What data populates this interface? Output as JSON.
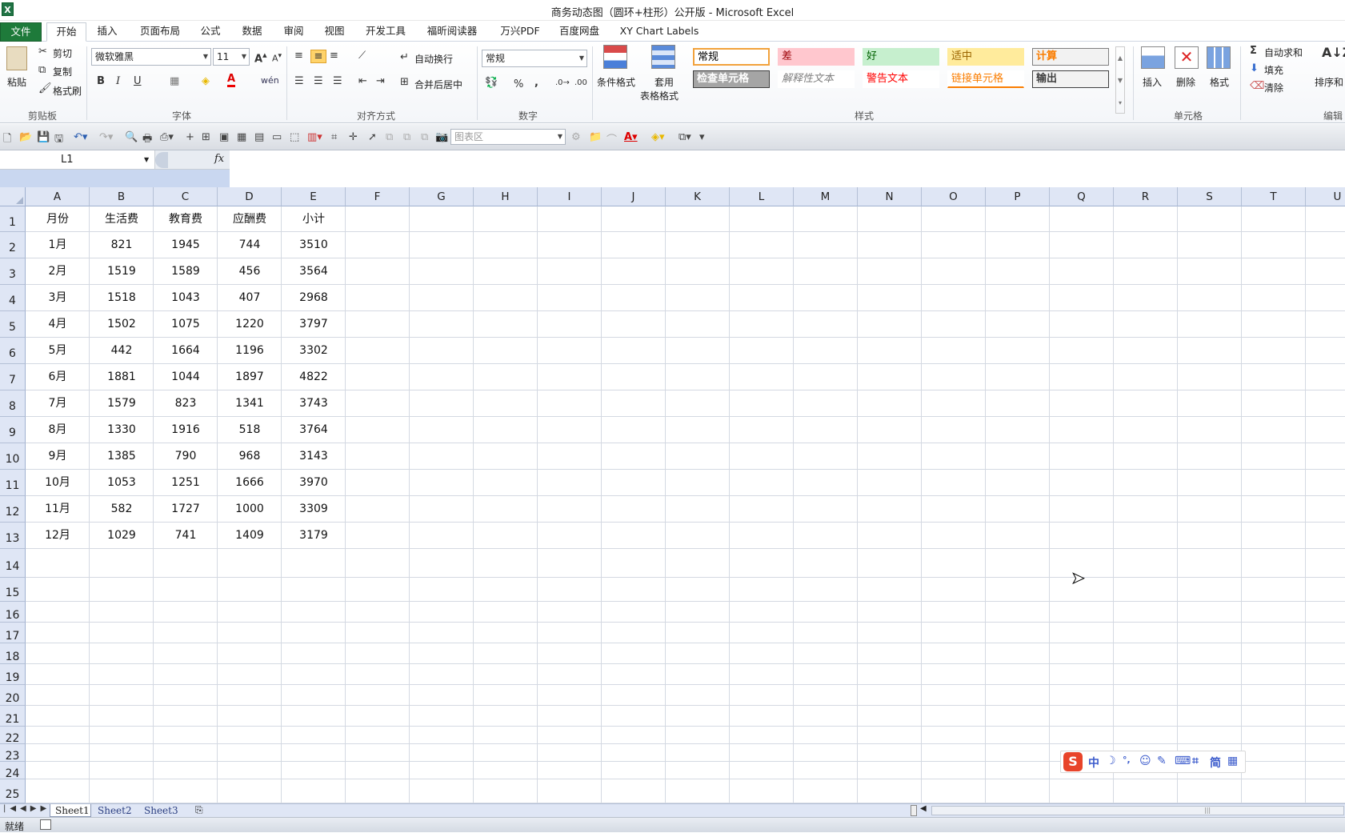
{
  "window": {
    "title": "商务动态图（圆环+柱形）公开版 - Microsoft Excel",
    "app_icon": "X"
  },
  "tabs": [
    "文件",
    "开始",
    "插入",
    "页面布局",
    "公式",
    "数据",
    "审阅",
    "视图",
    "开发工具",
    "福昕阅读器",
    "万兴PDF",
    "百度网盘",
    "XY Chart Labels"
  ],
  "ribbon": {
    "clipboard": {
      "paste": "粘贴",
      "cut": "剪切",
      "copy": "复制",
      "format_painter": "格式刷",
      "label": "剪贴板"
    },
    "font": {
      "name": "微软雅黑",
      "size": "11",
      "bold": "B",
      "italic": "I",
      "underline": "U",
      "label": "字体",
      "wen": "wén"
    },
    "alignment": {
      "wrap": "自动换行",
      "merge": "合并后居中",
      "label": "对齐方式"
    },
    "number": {
      "format": "常规",
      "percent": "%",
      "comma": ",",
      "label": "数字"
    },
    "styles": {
      "conditional": "条件格式",
      "table_format": "套用",
      "table_format2": "表格格式",
      "cells": [
        {
          "text": "常规",
          "bg": "#ffffff",
          "color": "#000000",
          "border": "#f2a23c"
        },
        {
          "text": "差",
          "bg": "#ffc7ce",
          "color": "#9c0006",
          "border": ""
        },
        {
          "text": "好",
          "bg": "#c6efce",
          "color": "#006100",
          "border": ""
        },
        {
          "text": "适中",
          "bg": "#ffeb9c",
          "color": "#9c6500",
          "border": ""
        },
        {
          "text": "计算",
          "bg": "#f2f2f2",
          "color": "#fa7d00",
          "border": "#7f7f7f"
        },
        {
          "text": "检查单元格",
          "bg": "#a5a5a5",
          "color": "#ffffff",
          "border": "#3f3f3f"
        },
        {
          "text": "解释性文本",
          "bg": "#ffffff",
          "color": "#7f7f7f",
          "border": ""
        },
        {
          "text": "警告文本",
          "bg": "#ffffff",
          "color": "#ff0000",
          "border": ""
        },
        {
          "text": "链接单元格",
          "bg": "#ffffff",
          "color": "#fa7d00",
          "border": ""
        },
        {
          "text": "输出",
          "bg": "#f2f2f2",
          "color": "#3f3f3f",
          "border": "#3f3f3f"
        }
      ],
      "label": "样式"
    },
    "cells_group": {
      "insert": "插入",
      "delete": "删除",
      "format": "格式",
      "label": "单元格"
    },
    "editing": {
      "autosum": "自动求和",
      "fill": "填充",
      "clear": "清除",
      "sort": "排序和",
      "label": "编辑"
    }
  },
  "qat": {
    "chart_area": "图表区"
  },
  "formula_bar": {
    "name_box": "L1",
    "fx": "fx"
  },
  "columns": [
    "A",
    "B",
    "C",
    "D",
    "E",
    "F",
    "G",
    "H",
    "I",
    "J",
    "K",
    "L",
    "M",
    "N",
    "O",
    "P",
    "Q",
    "R",
    "S",
    "T",
    "U"
  ],
  "rows": [
    "1",
    "2",
    "3",
    "4",
    "5",
    "6",
    "7",
    "8",
    "9",
    "10",
    "11",
    "12",
    "13",
    "14",
    "15",
    "16",
    "17",
    "18",
    "19",
    "20",
    "21",
    "22",
    "23",
    "24",
    "25"
  ],
  "table": {
    "headers": [
      "月份",
      "生活费",
      "教育费",
      "应酬费",
      "小计"
    ],
    "rows": [
      [
        "1月",
        "821",
        "1945",
        "744",
        "3510"
      ],
      [
        "2月",
        "1519",
        "1589",
        "456",
        "3564"
      ],
      [
        "3月",
        "1518",
        "1043",
        "407",
        "2968"
      ],
      [
        "4月",
        "1502",
        "1075",
        "1220",
        "3797"
      ],
      [
        "5月",
        "442",
        "1664",
        "1196",
        "3302"
      ],
      [
        "6月",
        "1881",
        "1044",
        "1897",
        "4822"
      ],
      [
        "7月",
        "1579",
        "823",
        "1341",
        "3743"
      ],
      [
        "8月",
        "1330",
        "1916",
        "518",
        "3764"
      ],
      [
        "9月",
        "1385",
        "790",
        "968",
        "3143"
      ],
      [
        "10月",
        "1053",
        "1251",
        "1666",
        "3970"
      ],
      [
        "11月",
        "582",
        "1727",
        "1000",
        "3309"
      ],
      [
        "12月",
        "1029",
        "741",
        "1409",
        "3179"
      ]
    ]
  },
  "ime": {
    "items": [
      "S",
      "中",
      "☽",
      "°,",
      "☺",
      "✎",
      "⌨",
      "⌗",
      "简",
      "▦"
    ]
  },
  "sheets": [
    "Sheet1",
    "Sheet2",
    "Sheet3"
  ],
  "status": {
    "text": "就绪"
  }
}
